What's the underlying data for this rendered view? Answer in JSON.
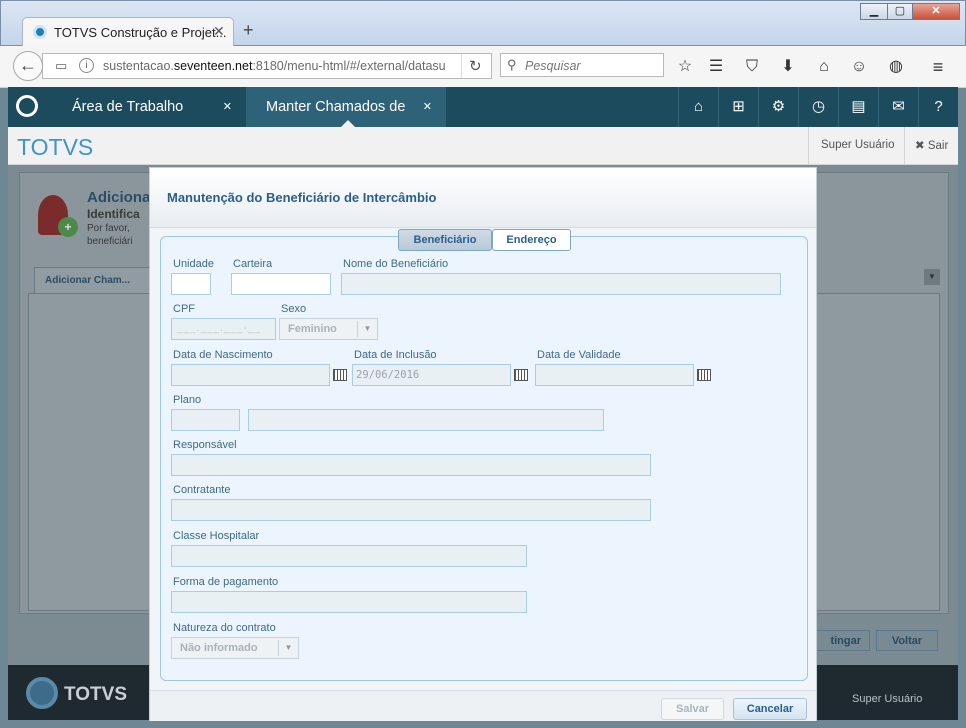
{
  "browser": {
    "tab_title": "TOTVS Construção e Projet...",
    "url_prefix": "sustentacao.",
    "url_domain": "seventeen.net",
    "url_rest": ":8180/menu-html/#/external/datasu",
    "search_placeholder": "Pesquisar"
  },
  "app": {
    "tabs": [
      {
        "label": "Área de Trabalho"
      },
      {
        "label": "Manter Chamados de"
      }
    ],
    "brand": "TOTVS",
    "user": "Super Usuário",
    "logout": "Sair",
    "colors": {
      "header": "#1d4b5e",
      "brand": "#3d95c9",
      "accent": "#2a5f8c"
    }
  },
  "background": {
    "title": "Adiciona",
    "line1": "Identifica",
    "line2": "Por favor,",
    "line3": "beneficiári",
    "tab": "Adicionar Cham...",
    "btn1": "tingar",
    "btn2": "Voltar",
    "footer_brand": "TOTVS",
    "footer_user": "Super Usuário"
  },
  "modal": {
    "title": "Manutenção do Beneficiário de Intercâmbio",
    "tabs": {
      "beneficiario": "Beneficiário",
      "endereco": "Endereço"
    },
    "fields": {
      "unidade": {
        "label": "Unidade",
        "value": ""
      },
      "carteira": {
        "label": "Carteira",
        "value": ""
      },
      "nome": {
        "label": "Nome do Beneficiário",
        "value": ""
      },
      "cpf": {
        "label": "CPF",
        "value": "___.___.___-__"
      },
      "sexo": {
        "label": "Sexo",
        "value": "Feminino"
      },
      "data_nascimento": {
        "label": "Data de Nascimento",
        "value": ""
      },
      "data_inclusao": {
        "label": "Data de Inclusão",
        "value": "29/06/2016"
      },
      "data_validade": {
        "label": "Data de Validade",
        "value": ""
      },
      "plano": {
        "label": "Plano",
        "value": ""
      },
      "responsavel": {
        "label": "Responsável",
        "value": ""
      },
      "contratante": {
        "label": "Contratante",
        "value": ""
      },
      "classe": {
        "label": "Classe Hospitalar",
        "value": ""
      },
      "forma_pagamento": {
        "label": "Forma de pagamento",
        "value": ""
      },
      "natureza": {
        "label": "Natureza do contrato",
        "value": "Não informado"
      }
    },
    "buttons": {
      "salvar": "Salvar",
      "cancelar": "Cancelar"
    }
  }
}
